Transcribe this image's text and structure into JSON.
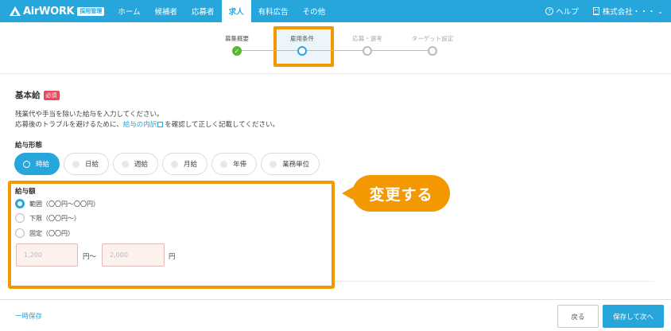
{
  "header": {
    "logo_text": "AirWORK",
    "logo_badge": "採用管理",
    "nav": [
      "ホーム",
      "候補者",
      "応募者",
      "求人",
      "有料広告",
      "その他"
    ],
    "active_nav": "求人",
    "help_label": "ヘルプ",
    "company_label": "株式会社・・・"
  },
  "stepper": {
    "steps": [
      {
        "label": "募集概要",
        "state": "done"
      },
      {
        "label": "雇用条件",
        "state": "current"
      },
      {
        "label": "応募・選考",
        "state": "future"
      },
      {
        "label": "ターゲット設定",
        "state": "future"
      }
    ]
  },
  "form": {
    "section_title": "基本給",
    "required_badge": "必須",
    "desc_line1": "残業代や手当を除いた給与を入力してください。",
    "desc_line2_pre": "応募後のトラブルを避けるために、",
    "desc_line2_link": "給与の内訳",
    "desc_line2_post": "を確認して正しく記載してください。",
    "type_label": "給与形態",
    "pay_types": [
      "時給",
      "日給",
      "週給",
      "月給",
      "年俸",
      "業務単位"
    ],
    "selected_pay_type": "時給",
    "amount_label": "給与額",
    "amount_options": [
      "範囲（〇〇円〜〇〇円）",
      "下限（〇〇円〜）",
      "固定（〇〇円）"
    ],
    "selected_amount_option": "範囲（〇〇円〜〇〇円）",
    "min_placeholder": "1,200",
    "max_placeholder": "2,000",
    "range_sep": "円〜",
    "unit": "円"
  },
  "callout": {
    "text": "変更する"
  },
  "footer": {
    "temp_save": "一時保存",
    "back": "戻る",
    "next": "保存して次へ"
  },
  "colors": {
    "brand": "#27a6dc",
    "highlight": "#f39800",
    "done": "#5cb531",
    "required": "#e9495c"
  }
}
